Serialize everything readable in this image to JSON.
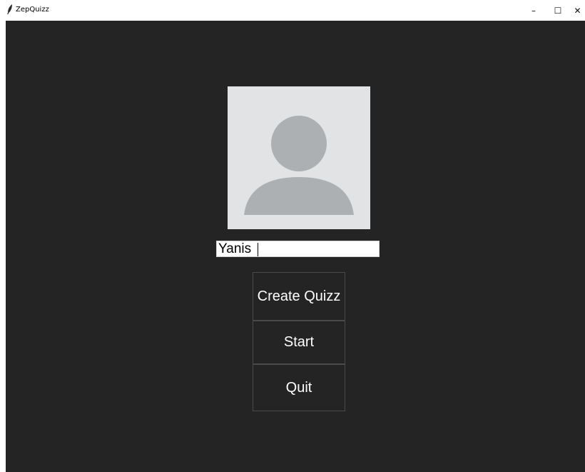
{
  "window": {
    "title": "ZepQuizz",
    "controls": {
      "minimize": "–",
      "maximize": "☐",
      "close": "✕"
    }
  },
  "main": {
    "name_input": {
      "value": "Yanis"
    },
    "buttons": {
      "create": "Create Quizz",
      "start": "Start",
      "quit": "Quit"
    }
  },
  "colors": {
    "background": "#242424",
    "avatar_bg": "#e2e3e4",
    "avatar_figure": "#acb0b3",
    "button_text": "#ffffff"
  },
  "icons": {
    "app": "feather-icon",
    "avatar": "user-placeholder-icon"
  }
}
